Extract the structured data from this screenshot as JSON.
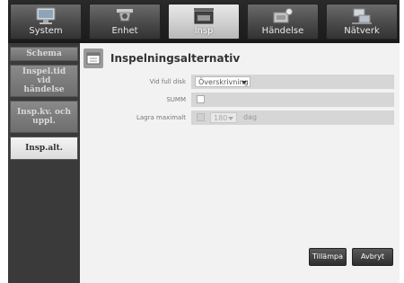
{
  "top_tabs": [
    {
      "label": "System",
      "icon": "monitor-icon",
      "active": false
    },
    {
      "label": "Enhet",
      "icon": "camera-icon",
      "active": false
    },
    {
      "label": "Insp",
      "icon": "rec-icon",
      "active": true
    },
    {
      "label": "Händelse",
      "icon": "event-icon",
      "active": false
    },
    {
      "label": "Nätverk",
      "icon": "network-icon",
      "active": false
    }
  ],
  "sidebar": {
    "items": [
      {
        "label": "Schema",
        "active": false
      },
      {
        "label": "Inspel.tid vid händelse",
        "active": false
      },
      {
        "label": "Insp.kv. och uppl.",
        "active": false
      },
      {
        "label": "Insp.alt.",
        "active": true
      }
    ]
  },
  "main": {
    "title": "Inspelningsalternativ",
    "rows": {
      "full_disk": {
        "label": "Vid full disk",
        "value": "Överskrivning"
      },
      "summ": {
        "label": "SUMM",
        "checked": false
      },
      "max_save": {
        "label": "Lagra maximalt",
        "checked": false,
        "value": "180",
        "unit": "dag"
      }
    }
  },
  "buttons": {
    "apply": "Tillämpa",
    "cancel": "Avbryt"
  },
  "colors": {
    "sidebar_bg": "#3a3a3a",
    "panel_bg": "#f2f2f2",
    "active_tab": "#cfcfcf"
  }
}
